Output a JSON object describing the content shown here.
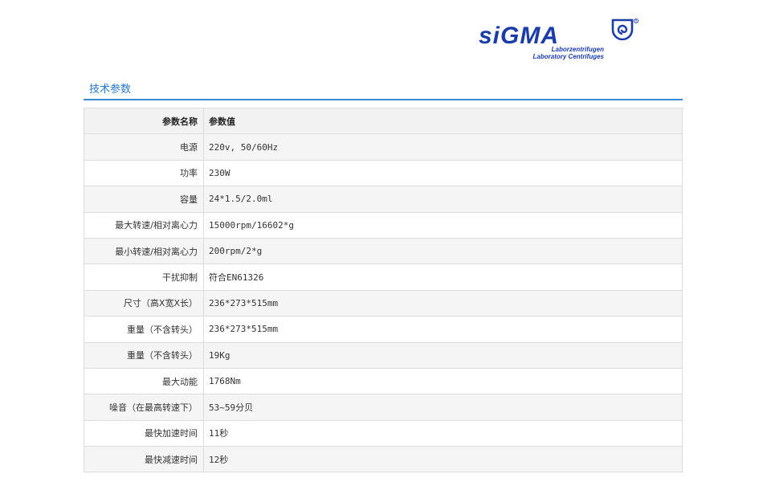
{
  "brand": {
    "name": "SIGMA",
    "wordmark": "siGMA",
    "registered_mark": "®",
    "subtitle_de": "Laborzentrifugen",
    "subtitle_en": "Laboratory Centrifuges",
    "brand_color": "#1a3ca8"
  },
  "section": {
    "title": "技术参数",
    "accent_color": "#3a8ad6"
  },
  "table": {
    "headers": [
      "参数名称",
      "参数值"
    ],
    "rows": [
      {
        "name": "电源",
        "value": "220v, 50/60Hz"
      },
      {
        "name": "功率",
        "value": "230W"
      },
      {
        "name": "容量",
        "value": "24*1.5/2.0ml"
      },
      {
        "name": "最大转速/相对离心力",
        "value": "15000rpm/16602*g"
      },
      {
        "name": "最小转速/相对离心力",
        "value": "200rpm/2*g"
      },
      {
        "name": "干扰抑制",
        "value": "符合EN61326"
      },
      {
        "name": "尺寸（高X宽X长）",
        "value": "236*273*515mm"
      },
      {
        "name": "重量（不含转头）",
        "value": "236*273*515mm"
      },
      {
        "name": "重量（不含转头）",
        "value": "19Kg"
      },
      {
        "name": "最大动能",
        "value": "1768Nm"
      },
      {
        "name": "噪音（在最高转速下）",
        "value": "53~59分贝"
      },
      {
        "name": "最快加速时间",
        "value": "11秒"
      },
      {
        "name": "最快减速时间",
        "value": "12秒"
      }
    ]
  }
}
